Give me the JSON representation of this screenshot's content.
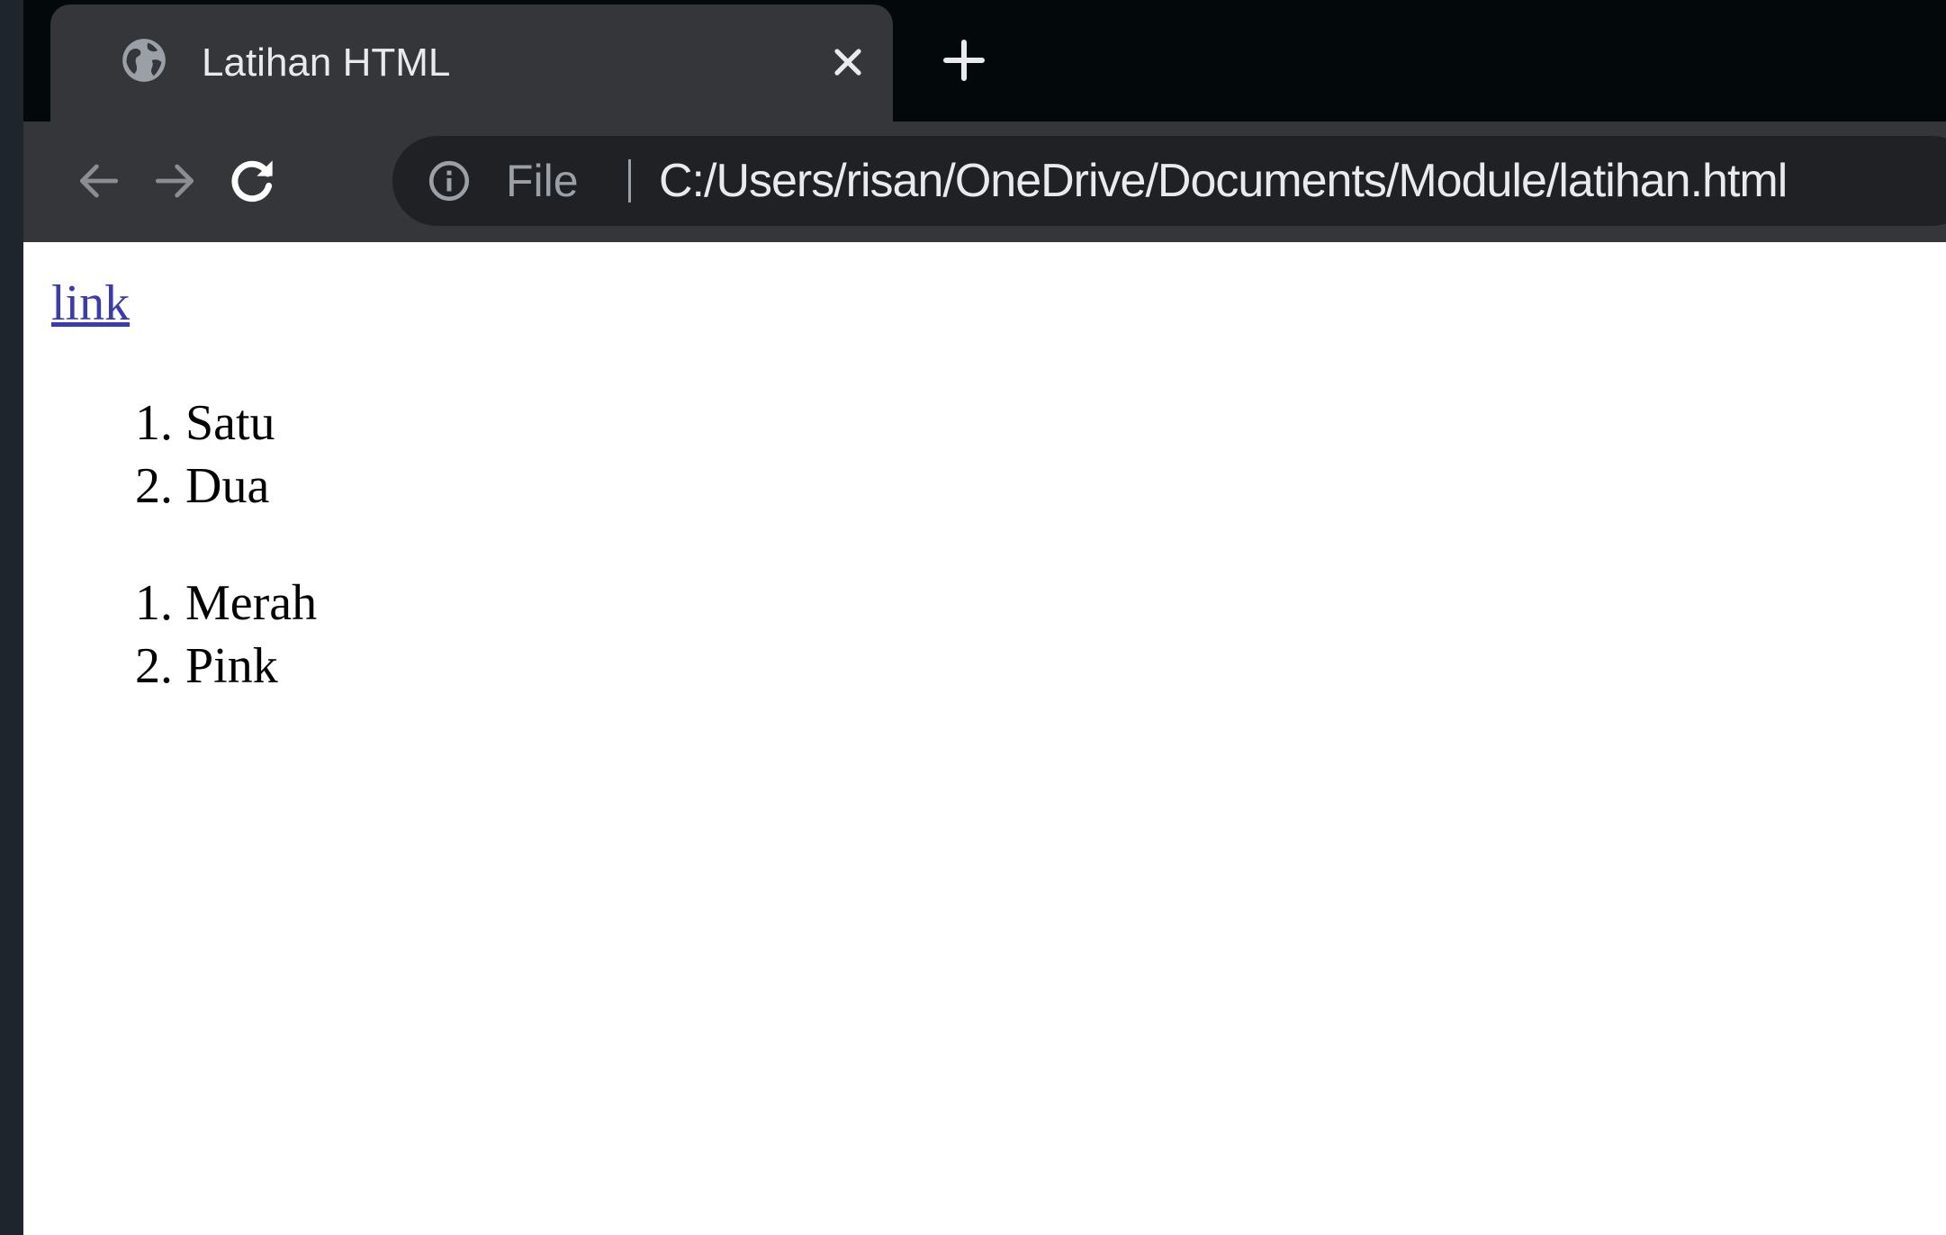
{
  "tab": {
    "title": "Latihan HTML",
    "icon": "globe-icon"
  },
  "toolbar": {
    "back_icon": "arrow-left-icon",
    "forward_icon": "arrow-right-icon",
    "reload_icon": "reload-icon",
    "new_tab_icon": "plus-icon"
  },
  "omnibox": {
    "scheme_label": "File",
    "url": "C:/Users/risan/OneDrive/Documents/Module/latihan.html",
    "info_icon": "info-icon"
  },
  "page": {
    "link_text": "link",
    "list_one": [
      "Satu",
      "Dua"
    ],
    "list_two": [
      "Merah",
      "Pink"
    ]
  },
  "colors": {
    "tabstrip": "#03080b",
    "tab_active": "#35363a",
    "toolbar": "#35363a",
    "omnibox": "#202124",
    "link": "#3a3ab4"
  }
}
